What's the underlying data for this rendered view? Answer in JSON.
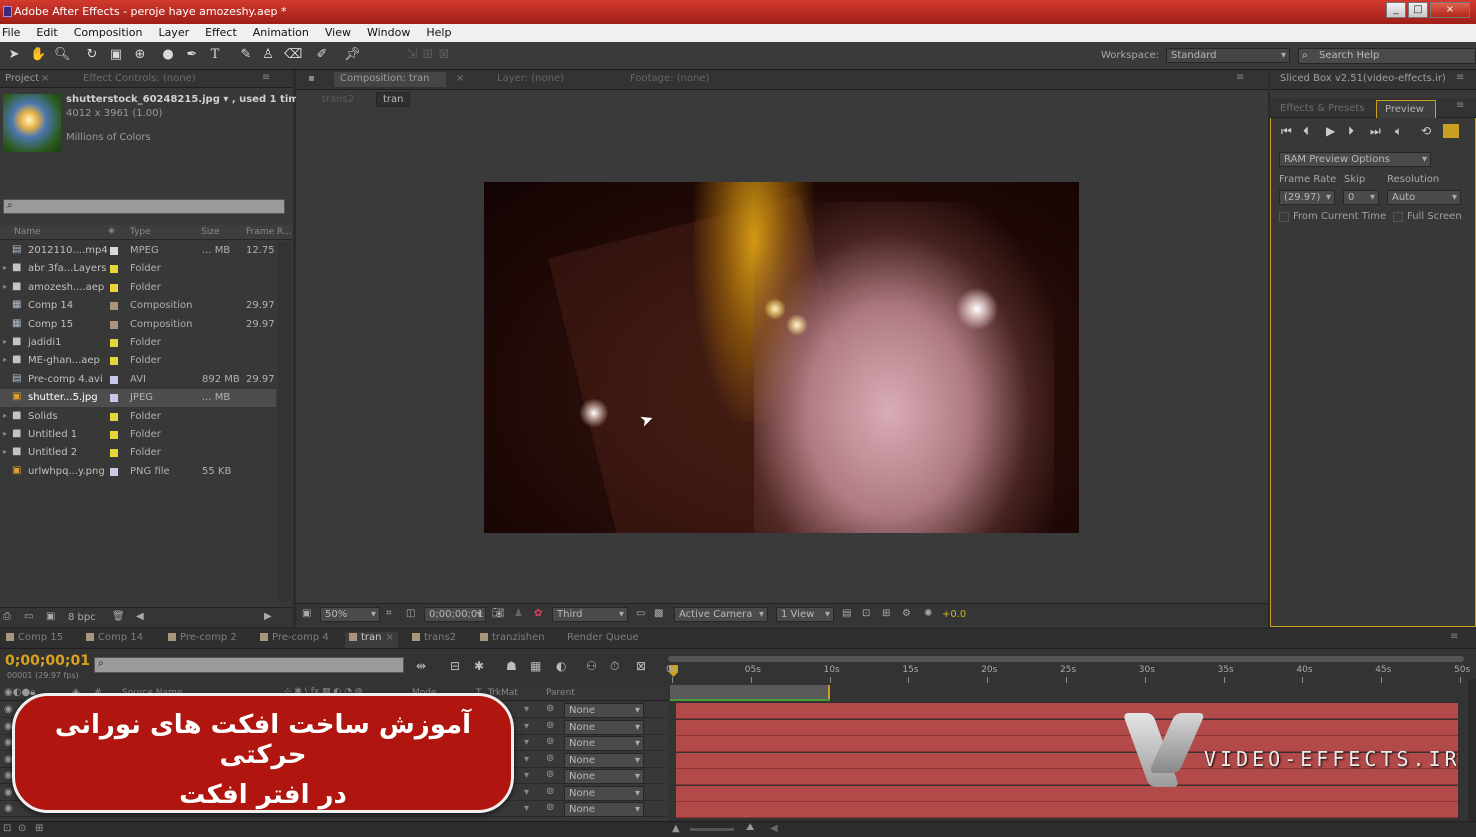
{
  "window": {
    "title": "Adobe After Effects - peroje haye amozeshy.aep *",
    "controls": [
      "_",
      "□",
      "×"
    ]
  },
  "menu": [
    "File",
    "Edit",
    "Composition",
    "Layer",
    "Effect",
    "Animation",
    "View",
    "Window",
    "Help"
  ],
  "toolbar": {
    "workspace_label": "Workspace:",
    "workspace_value": "Standard",
    "search_placeholder": "Search Help"
  },
  "project": {
    "tab_project": "Project",
    "tab_effect_controls": "Effect Controls: (none)",
    "asset_name": "shutterstock_60248215.jpg ▾ , used 1 time",
    "asset_dims": "4012 x 3961 (1.00)",
    "asset_colors": "Millions of Colors",
    "columns": [
      "Name",
      "Type",
      "Size",
      "Frame R..."
    ],
    "items": [
      {
        "name": "2012110....mp4",
        "type": "MPEG",
        "size": "... MB",
        "fr": "12.75",
        "color": "#d9d9d9",
        "kind": "file"
      },
      {
        "name": "abr 3fa...Layers",
        "type": "Folder",
        "size": "",
        "fr": "",
        "color": "#e8d33a",
        "kind": "folder"
      },
      {
        "name": "amozesh....aep",
        "type": "Folder",
        "size": "",
        "fr": "",
        "color": "#e8d33a",
        "kind": "folder"
      },
      {
        "name": "Comp 14",
        "type": "Composition",
        "size": "",
        "fr": "29.97",
        "color": "#a8957a",
        "kind": "comp"
      },
      {
        "name": "Comp 15",
        "type": "Composition",
        "size": "",
        "fr": "29.97",
        "color": "#a8957a",
        "kind": "comp"
      },
      {
        "name": "jadidi1",
        "type": "Folder",
        "size": "",
        "fr": "",
        "color": "#e8d33a",
        "kind": "folder"
      },
      {
        "name": "ME-ghan...aep",
        "type": "Folder",
        "size": "",
        "fr": "",
        "color": "#e8d33a",
        "kind": "folder"
      },
      {
        "name": "Pre-comp 4.avi",
        "type": "AVI",
        "size": "892 MB",
        "fr": "29.97",
        "color": "#c8c8e8",
        "kind": "file"
      },
      {
        "name": "shutter...5.jpg",
        "type": "JPEG",
        "size": "... MB",
        "fr": "",
        "color": "#c8c8e8",
        "kind": "image"
      },
      {
        "name": "Solids",
        "type": "Folder",
        "size": "",
        "fr": "",
        "color": "#e8d33a",
        "kind": "folder"
      },
      {
        "name": "Untitled 1",
        "type": "Folder",
        "size": "",
        "fr": "",
        "color": "#e8d33a",
        "kind": "folder"
      },
      {
        "name": "Untitled 2",
        "type": "Folder",
        "size": "",
        "fr": "",
        "color": "#e8d33a",
        "kind": "folder"
      },
      {
        "name": "urlwhpq...y.png",
        "type": "PNG file",
        "size": "55 KB",
        "fr": "",
        "color": "#c8c8e8",
        "kind": "image"
      }
    ],
    "bpc": "8 bpc"
  },
  "composition": {
    "tab_comp": "Composition: tran",
    "tab_layer": "Layer: (none)",
    "tab_footage": "Footage: (none)",
    "crumbs": [
      "trans2",
      "tran"
    ],
    "zoom": "50%",
    "timecode": "0;00;00;01",
    "resolution": "Third",
    "camera": "Active Camera",
    "views": "1 View",
    "exposure": "+0.0"
  },
  "right": {
    "top_title": "Sliced Box v2.51(video-effects.ir)",
    "tab_effects": "Effects & Presets",
    "tab_preview": "Preview",
    "ram_options": "RAM Preview Options",
    "frame_rate_label": "Frame Rate",
    "skip_label": "Skip",
    "resolution_label": "Resolution",
    "frame_rate": "(29.97)",
    "skip": "0",
    "resolution": "Auto",
    "from_current": "From Current Time",
    "full_screen": "Full Screen"
  },
  "timeline": {
    "tabs": [
      {
        "label": "Comp 15",
        "color": "#a8957a"
      },
      {
        "label": "Comp 14",
        "color": "#a8957a"
      },
      {
        "label": "Pre-comp 2",
        "color": "#a8957a"
      },
      {
        "label": "Pre-comp 4",
        "color": "#a8957a"
      },
      {
        "label": "tran",
        "color": "#a8957a"
      },
      {
        "label": "trans2",
        "color": "#a8957a"
      },
      {
        "label": "tranzishen",
        "color": "#a8957a"
      },
      {
        "label": "Render Queue",
        "color": ""
      }
    ],
    "timecode": "0;00;00;01",
    "timecode_sub": "00001 (29.97 fps)",
    "col_source": "Source Name",
    "col_mode": "Mode",
    "col_t": "T",
    "col_trkmat": "TrkMat",
    "col_parent": "Parent",
    "ruler": [
      "0s",
      "05s",
      "10s",
      "15s",
      "20s",
      "25s",
      "30s",
      "35s",
      "40s",
      "45s",
      "50s"
    ],
    "parent_value": "None"
  },
  "overlay": {
    "line1": "آموزش ساخت افکت های نورانی حرکتی",
    "line2": "در افتر افکت",
    "watermark": "VIDEO-EFFECTS.IR"
  }
}
